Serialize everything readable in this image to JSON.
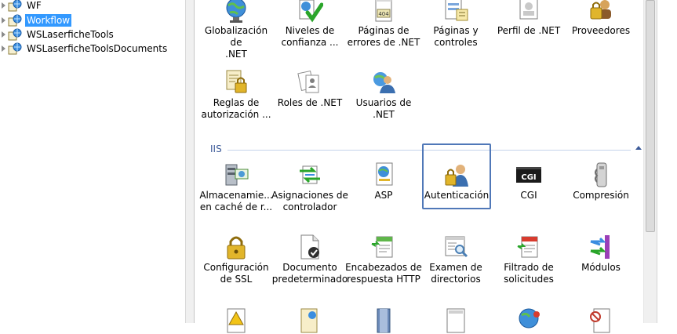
{
  "tree": {
    "items": [
      {
        "label": "WF",
        "selected": false
      },
      {
        "label": "Workflow",
        "selected": true
      },
      {
        "label": "WSLaserficheTools",
        "selected": false
      },
      {
        "label": "WSLaserficheToolsDocuments",
        "selected": false
      }
    ]
  },
  "features": {
    "net_row1": [
      {
        "label": "Globalización de\n.NET",
        "icon": "globe-icon"
      },
      {
        "label": "Niveles de\nconfianza ...",
        "icon": "trust-checkmark-icon"
      },
      {
        "label": "Páginas de\nerrores de .NET",
        "icon": "error-page-404-icon"
      },
      {
        "label": "Páginas y\ncontroles",
        "icon": "pages-controls-icon"
      },
      {
        "label": "Perfil de .NET",
        "icon": "profile-icon"
      },
      {
        "label": "Proveedores",
        "icon": "providers-icon"
      }
    ],
    "net_row2": [
      {
        "label": "Reglas de\nautorización ...",
        "icon": "authorization-rules-icon"
      },
      {
        "label": "Roles de .NET",
        "icon": "roles-icon"
      },
      {
        "label": "Usuarios de .NET",
        "icon": "users-icon"
      }
    ],
    "iis_group": {
      "label": "IIS"
    },
    "iis_row1": [
      {
        "label": "Almacenamie...\nen caché de r...",
        "icon": "output-cache-icon"
      },
      {
        "label": "Asignaciones de\ncontrolador",
        "icon": "handler-mappings-icon"
      },
      {
        "label": "ASP",
        "icon": "asp-icon"
      },
      {
        "label": "Autenticación",
        "icon": "authentication-icon"
      },
      {
        "label": "CGI",
        "icon": "cgi-icon"
      },
      {
        "label": "Compresión",
        "icon": "compression-icon"
      }
    ],
    "iis_row2": [
      {
        "label": "Configuración\nde SSL",
        "icon": "ssl-lock-icon"
      },
      {
        "label": "Documento\npredeterminado",
        "icon": "default-document-icon"
      },
      {
        "label": "Encabezados de\nrespuesta HTTP",
        "icon": "http-headers-icon"
      },
      {
        "label": "Examen de\ndirectorios",
        "icon": "directory-browsing-icon"
      },
      {
        "label": "Filtrado de\nsolicitudes",
        "icon": "request-filtering-icon"
      },
      {
        "label": "Módulos",
        "icon": "modules-icon"
      }
    ]
  },
  "colors": {
    "selection": "#3399ff",
    "group_header": "#3c5a99",
    "highlight_border": "#5078b8"
  }
}
